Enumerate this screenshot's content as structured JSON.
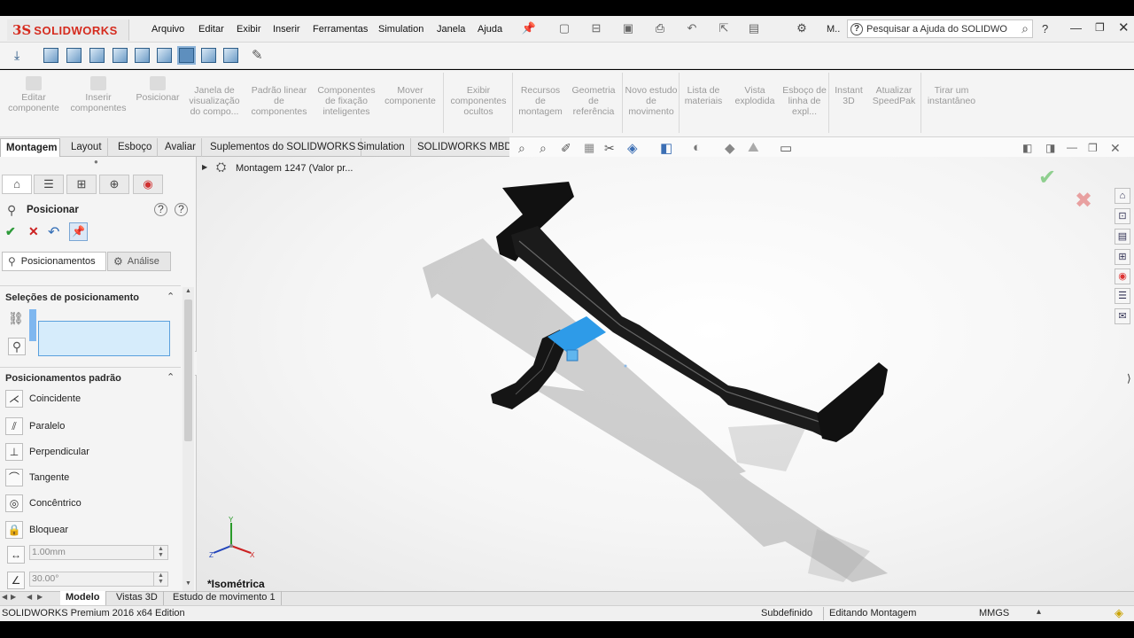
{
  "app": {
    "brand_ds": "3S",
    "brand_name": "SOLIDWORKS"
  },
  "menu": [
    "Arquivo",
    "Editar",
    "Exibir",
    "Inserir",
    "Ferramentas",
    "Simulation",
    "Janela",
    "Ajuda"
  ],
  "header": {
    "short_label": "M..",
    "search_placeholder": "Pesquisar a Ajuda do SOLIDWO",
    "help": "?"
  },
  "ribbon": [
    "Editar componente",
    "Inserir componentes",
    "Posicionar",
    "Janela de visualização do compo...",
    "Padrão linear de componentes",
    "Componentes de fixação inteligentes",
    "Mover componente",
    "Exibir componentes ocultos",
    "Recursos de montagem",
    "Geometria de referência",
    "Novo estudo de movimento",
    "Lista de materiais",
    "Vista explodida",
    "Esboço de linha de expl...",
    "Instant 3D",
    "Atualizar SpeedPak",
    "Tirar um instantâneo"
  ],
  "tabs": [
    "Montagem",
    "Layout",
    "Esboço",
    "Avaliar",
    "Suplementos do SOLIDWORKS",
    "Simulation",
    "SOLIDWORKS MBD"
  ],
  "panel": {
    "title": "Posicionar",
    "subtabs": {
      "mates": "Posicionamentos",
      "analysis": "Análise"
    },
    "selections_title": "Seleções de posicionamento",
    "standard_title": "Posicionamentos padrão",
    "mates": [
      "Coincidente",
      "Paralelo",
      "Perpendicular",
      "Tangente",
      "Concêntrico",
      "Bloquear"
    ],
    "distance": "1.00mm",
    "angle": "30.00°"
  },
  "tree": {
    "root": "Montagem 1247  (Valor pr..."
  },
  "viewport": {
    "view_name": "*Isométrica"
  },
  "triad": {
    "x": "X",
    "y": "Y",
    "z": "Z"
  },
  "bottom_tabs": [
    "Modelo",
    "Vistas 3D",
    "Estudo de movimento 1"
  ],
  "status": {
    "edition": "SOLIDWORKS Premium 2016 x64 Edition",
    "state": "Subdefinido",
    "mode": "Editando Montagem",
    "units": "MMGS"
  },
  "colors": {
    "brand": "#d52b1e",
    "selection": "#2e9be8",
    "accept": "#2e9b3a",
    "cancel": "#cc2222",
    "frame": "#111111"
  },
  "icons": [
    "search-icon",
    "gear-icon",
    "help-icon",
    "check-icon",
    "close-icon",
    "pin-icon",
    "undo-icon",
    "triad-icon"
  ]
}
